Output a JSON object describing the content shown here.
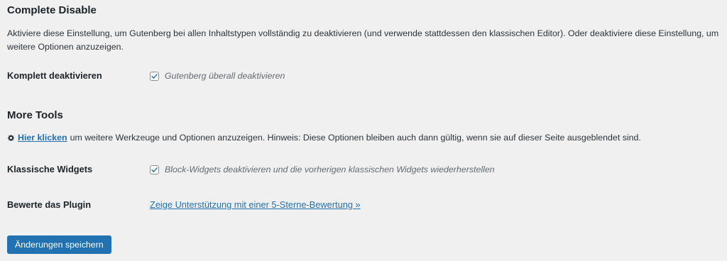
{
  "section1": {
    "title": "Complete Disable",
    "description": "Aktiviere diese Einstellung, um Gutenberg bei allen Inhaltstypen vollständig zu deaktivieren (und verwende stattdessen den klassischen Editor). Oder deaktiviere diese Einstellung, um weitere Optionen anzuzeigen.",
    "rows": [
      {
        "label": "Komplett deaktivieren",
        "checkbox_label": "Gutenberg überall deaktivieren",
        "checked": true
      }
    ]
  },
  "section2": {
    "title": "More Tools",
    "hint_icon": "gear-icon",
    "hint_link": "Hier klicken",
    "hint_text": "um weitere Werkzeuge und Optionen anzuzeigen. Hinweis: Diese Optionen bleiben auch dann gültig, wenn sie auf dieser Seite ausgeblendet sind.",
    "rows": [
      {
        "label": "Klassische Widgets",
        "checkbox_label": "Block-Widgets deaktivieren und die vorherigen klassischen Widgets wiederherstellen",
        "checked": true
      },
      {
        "label": "Bewerte das Plugin",
        "link_text": "Zeige Unterstützung mit einer 5-Sterne-Bewertung »"
      }
    ]
  },
  "save_button": "Änderungen speichern",
  "colors": {
    "background": "#f0f0f1",
    "primary": "#2271b1",
    "text": "#1d2327",
    "muted": "#646970"
  }
}
